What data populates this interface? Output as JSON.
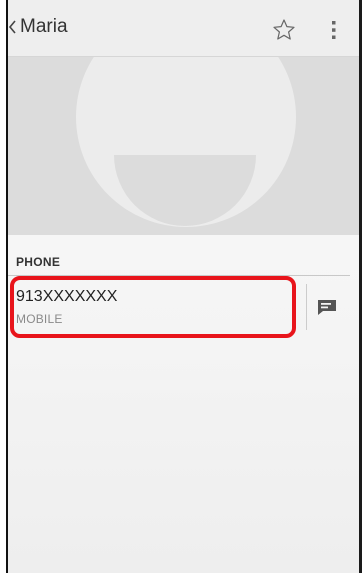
{
  "header": {
    "title": "Maria",
    "back_icon": "chevron-left-icon",
    "star_icon": "star-outline-icon",
    "menu_icon": "overflow-menu-icon"
  },
  "photo": {
    "placeholder_icon": "person-silhouette-icon"
  },
  "phone_section": {
    "header": "PHONE",
    "entries": [
      {
        "number": "913XXXXXXX",
        "type": "MOBILE",
        "action_icon": "message-icon"
      }
    ]
  },
  "colors": {
    "highlight": "#e8141b",
    "topbar_bg": "#eeeeee",
    "photo_bg": "#dcdcdc",
    "silhouette": "#ececec"
  }
}
